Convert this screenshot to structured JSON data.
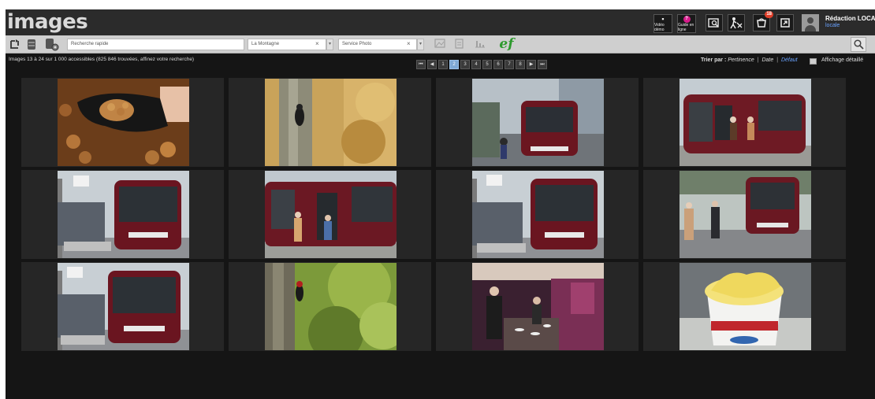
{
  "header": {
    "logo": "images",
    "video_label": "Vidéo démo",
    "guide_label": "Guide en ligne",
    "guide_symbol": "?",
    "notification_count": "18",
    "user_name": "Rédaction LOCALE",
    "user_sub": "locale"
  },
  "toolbar": {
    "quick_search_placeholder": "Recherche rapide",
    "publication_value": "La Montagne",
    "service_value": "Service Photo",
    "clear_symbol": "×",
    "dropdown_symbol": "▾",
    "ef_logo": "ef"
  },
  "results": {
    "summary": "Images 13 à 24 sur 1 000 accessibles (825 846 trouvées, affinez votre recherche)"
  },
  "pagination": {
    "first": "⏮",
    "prev": "◀",
    "pages": [
      "1",
      "2",
      "3",
      "4",
      "5",
      "6",
      "7",
      "8"
    ],
    "current_page": "2",
    "next": "▶",
    "last": "⏭"
  },
  "sort": {
    "label": "Trier par :",
    "options": [
      "Pertinence",
      "Date",
      "Défaut"
    ],
    "active_option": "Défaut",
    "separator": "|",
    "detail_label": "Affichage détaillé"
  },
  "images": [
    {
      "subject": "hazelnuts-in-gloved-hand"
    },
    {
      "subject": "woodpecker-on-tree-autumn"
    },
    {
      "subject": "red-bus-at-station-front"
    },
    {
      "subject": "red-bus-passengers-boarding"
    },
    {
      "subject": "red-bus-stop-40-sign"
    },
    {
      "subject": "red-bus-side-passengers"
    },
    {
      "subject": "red-bus-stop-40-sign-2"
    },
    {
      "subject": "red-bus-approaching-stop"
    },
    {
      "subject": "red-bus-stop-40-sign-3"
    },
    {
      "subject": "woodpecker-green-forest"
    },
    {
      "subject": "restaurant-dining-room-chef"
    },
    {
      "subject": "beurre-disigny-tub"
    }
  ],
  "colors": {
    "accent_blue": "#6aa3ff",
    "pager_current": "#7fa9d4",
    "ef_green": "#2e9a2e",
    "badge_red": "#e0402b",
    "guide_pink": "#d81b8b"
  }
}
